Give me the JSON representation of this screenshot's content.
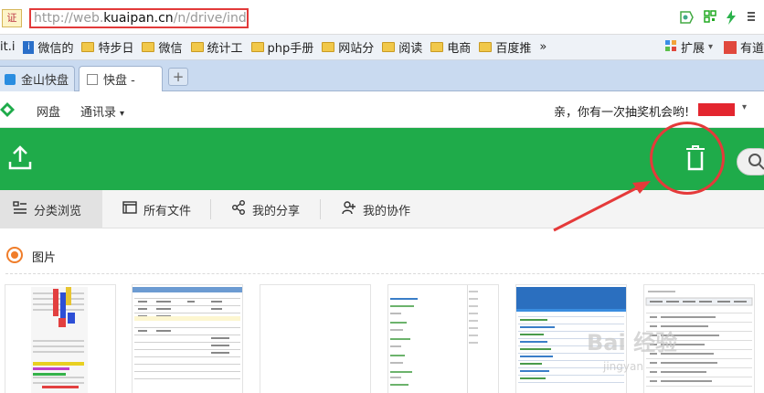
{
  "browser": {
    "cert_label": "证",
    "url_prefix": "http://web.",
    "url_domain": "kuaipan.cn",
    "url_path": "/n/drive/index"
  },
  "bookmarks": {
    "items": [
      {
        "label": "it.i",
        "icon": "text"
      },
      {
        "label": "微信的",
        "icon": "info-icon"
      },
      {
        "label": "特步日",
        "icon": "folder-icon"
      },
      {
        "label": "微信",
        "icon": "folder-icon"
      },
      {
        "label": "统计工",
        "icon": "folder-icon"
      },
      {
        "label": "php手册",
        "icon": "folder-icon"
      },
      {
        "label": "网站分",
        "icon": "folder-icon"
      },
      {
        "label": "阅读",
        "icon": "folder-icon"
      },
      {
        "label": "电商",
        "icon": "folder-icon"
      },
      {
        "label": "百度推",
        "icon": "folder-icon"
      }
    ],
    "more": "»",
    "extend_label": "扩展",
    "extend_chevron": "▾",
    "tail_label": "有道"
  },
  "tabs": [
    {
      "label": "金山快盘"
    },
    {
      "label": "快盘 -"
    }
  ],
  "newtab": "+",
  "app": {
    "nav_disk": "网盘",
    "nav_contacts": "通讯录",
    "nav_chevron": "▾",
    "promo": "亲，你有一次抽奖机会哟!",
    "user_chevron": "▾"
  },
  "content_tabs": [
    {
      "label": "分类浏览",
      "icon": "list-icon"
    },
    {
      "label": "所有文件",
      "icon": "window-icon"
    },
    {
      "label": "我的分享",
      "icon": "share-icon"
    },
    {
      "label": "我的协作",
      "icon": "collab-icon"
    }
  ],
  "category_label": "图片",
  "watermark": {
    "main": "Bai 经验",
    "sub": "jingyan"
  },
  "colors": {
    "green": "#1fab4a",
    "annotation_red": "#e53a3a",
    "radio_orange": "#f07d2a"
  }
}
